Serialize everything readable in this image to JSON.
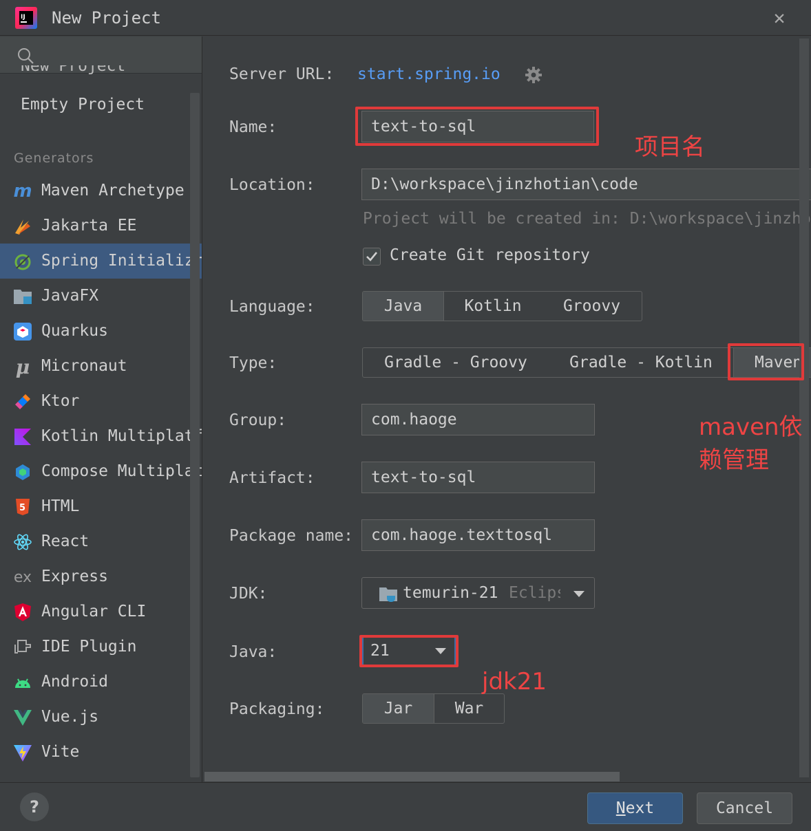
{
  "window": {
    "title": "New Project",
    "close_glyph": "✕"
  },
  "sidebar": {
    "peek_item": "New Project",
    "empty_project": "Empty Project",
    "section_label": "Generators",
    "items": [
      {
        "label": "Maven Archetype",
        "icon": "maven-icon"
      },
      {
        "label": "Jakarta EE",
        "icon": "jakarta-icon"
      },
      {
        "label": "Spring Initializr",
        "icon": "spring-icon"
      },
      {
        "label": "JavaFX",
        "icon": "javafx-icon"
      },
      {
        "label": "Quarkus",
        "icon": "quarkus-icon"
      },
      {
        "label": "Micronaut",
        "icon": "micronaut-icon"
      },
      {
        "label": "Ktor",
        "icon": "ktor-icon"
      },
      {
        "label": "Kotlin Multiplatform",
        "icon": "kotlin-icon"
      },
      {
        "label": "Compose Multiplatform",
        "icon": "compose-icon"
      },
      {
        "label": "HTML",
        "icon": "html5-icon"
      },
      {
        "label": "React",
        "icon": "react-icon"
      },
      {
        "label": "Express",
        "icon": "express-icon"
      },
      {
        "label": "Angular CLI",
        "icon": "angular-icon"
      },
      {
        "label": "IDE Plugin",
        "icon": "plugin-icon"
      },
      {
        "label": "Android",
        "icon": "android-icon"
      },
      {
        "label": "Vue.js",
        "icon": "vue-icon"
      },
      {
        "label": "Vite",
        "icon": "vite-icon"
      }
    ],
    "selected_item": "Spring Initializr"
  },
  "form": {
    "server_url_label": "Server URL:",
    "server_url": "start.spring.io",
    "name_label": "Name:",
    "name_value": "text-to-sql",
    "location_label": "Location:",
    "location_value": "D:\\workspace\\jinzhotian\\code",
    "location_hint": "Project will be created in: D:\\workspace\\jinzhotian\\code\\text-to-sql",
    "git_checkbox_label": "Create Git repository",
    "git_checked": true,
    "language_label": "Language:",
    "language_options": [
      "Java",
      "Kotlin",
      "Groovy"
    ],
    "language_selected": "Java",
    "type_label": "Type:",
    "type_options": [
      "Gradle - Groovy",
      "Gradle - Kotlin",
      "Maven"
    ],
    "type_selected": "Maven",
    "group_label": "Group:",
    "group_value": "com.haoge",
    "artifact_label": "Artifact:",
    "artifact_value": "text-to-sql",
    "package_label": "Package name:",
    "package_value": "com.haoge.texttosql",
    "jdk_label": "JDK:",
    "jdk_name": "temurin-21",
    "jdk_vendor": "Eclipse Adoptium",
    "java_label": "Java:",
    "java_value": "21",
    "packaging_label": "Packaging:",
    "packaging_options": [
      "Jar",
      "War"
    ],
    "packaging_selected": "Jar"
  },
  "annotations": {
    "name_note": "项目名",
    "maven_note_line1": "maven依",
    "maven_note_line2": "赖管理",
    "java_note": "jdk21",
    "color": "#e03a3a"
  },
  "footer": {
    "help": "?",
    "next_mnemonic": "N",
    "next_rest": "ext",
    "cancel": "Cancel"
  },
  "colors": {
    "background": "#3c3f41",
    "accent": "#589df6",
    "selection": "#3d5a80",
    "primary_button": "#365880"
  }
}
